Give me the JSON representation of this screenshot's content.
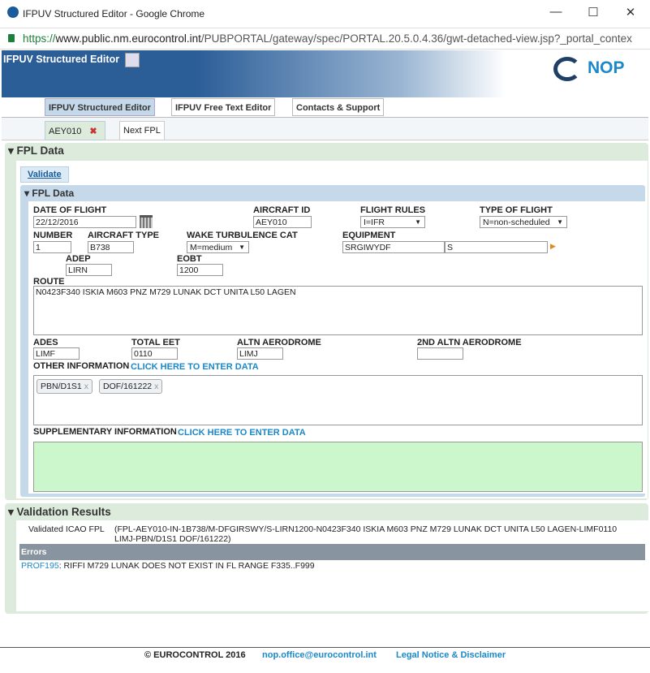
{
  "window": {
    "title": "IFPUV Structured Editor - Google Chrome",
    "minimize": "—",
    "maximize": "☐",
    "close": "✕"
  },
  "address": {
    "scheme": "https://",
    "host": "www.public.nm.eurocontrol.int",
    "path": "/PUBPORTAL/gateway/spec/PORTAL.20.5.0.4.36/gwt-detached-view.jsp?_portal_contex"
  },
  "banner": {
    "title": "IFPUV Structured Editor",
    "logo": "NOP"
  },
  "nav": {
    "tabs": [
      "IFPUV Structured Editor",
      "IFPUV Free Text Editor",
      "Contacts & Support"
    ]
  },
  "subtabs": {
    "fpl": "AEY010",
    "next": "Next FPL"
  },
  "fpl_section": {
    "title": "FPL Data",
    "validate": "Validate",
    "inner_title": "FPL Data"
  },
  "fields": {
    "date_of_flight": {
      "label": "DATE OF FLIGHT",
      "value": "22/12/2016"
    },
    "aircraft_id": {
      "label": "AIRCRAFT ID",
      "value": "AEY010"
    },
    "flight_rules": {
      "label": "FLIGHT RULES",
      "value": "I=IFR"
    },
    "type_of_flight": {
      "label": "TYPE OF FLIGHT",
      "value": "N=non-scheduled"
    },
    "number": {
      "label": "NUMBER",
      "value": "1"
    },
    "aircraft_type": {
      "label": "AIRCRAFT TYPE",
      "value": "B738"
    },
    "wake": {
      "label": "WAKE TURBULENCE CAT",
      "value": "M=medium"
    },
    "equipment": {
      "label": "EQUIPMENT",
      "value": "SRGIWYDF",
      "value2": "S"
    },
    "adep": {
      "label": "ADEP",
      "value": "LIRN"
    },
    "eobt": {
      "label": "EOBT",
      "value": "1200"
    },
    "route": {
      "label": "ROUTE",
      "value": "N0423F340 ISKIA M603 PNZ M729 LUNAK DCT UNITA L50 LAGEN"
    },
    "ades": {
      "label": "ADES",
      "value": "LIMF"
    },
    "total_eet": {
      "label": "TOTAL EET",
      "value": "0110"
    },
    "altn": {
      "label": "ALTN AERODROME",
      "value": "LIMJ"
    },
    "altn2": {
      "label": "2ND ALTN AERODROME",
      "value": ""
    },
    "other_info": {
      "label": "OTHER INFORMATION",
      "link": "CLICK HERE TO ENTER DATA",
      "chips": [
        "PBN/D1S1",
        "DOF/161222"
      ],
      "chip_remove": "x"
    },
    "supp_info": {
      "label": "SUPPLEMENTARY INFORMATION",
      "link": "CLICK HERE TO ENTER DATA"
    }
  },
  "validation": {
    "title": "Validation Results",
    "icao_label": "Validated ICAO FPL",
    "icao_line1": "(FPL-AEY010-IN-1B738/M-DFGIRSWY/S-LIRN1200-N0423F340 ISKIA M603 PNZ M729 LUNAK DCT UNITA L50 LAGEN-LIMF0110",
    "icao_line2": "LIMJ-PBN/D1S1 DOF/161222)",
    "errors_header": "Errors",
    "error_code": "PROF195",
    "error_text": ": RIFFI M729 LUNAK DOES NOT EXIST IN FL RANGE F335..F999"
  },
  "footer": {
    "copyright": "© EUROCONTROL 2016",
    "email": "nop.office@eurocontrol.int",
    "legal": "Legal Notice & Disclaimer"
  }
}
